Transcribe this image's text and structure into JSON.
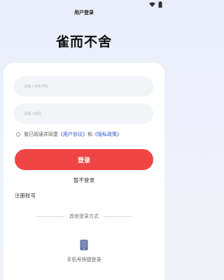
{
  "header": {
    "title": "用户登录"
  },
  "app": {
    "name": "雀而不舍"
  },
  "form": {
    "phone_placeholder": "请输入手机号码",
    "password_placeholder": "请输入密码"
  },
  "agreement": {
    "prefix": "我已阅读并同意",
    "user_agreement": "《用户协议》",
    "conjunction": "和",
    "privacy_policy": "《隐私政策》"
  },
  "actions": {
    "login_label": "登录",
    "skip_label": "暂不登录",
    "register_label": "注册账号"
  },
  "other_login": {
    "label": "其他登录方式",
    "phone_quick_label": "手机号快捷登录"
  },
  "colors": {
    "accent": "#ef4444",
    "link": "#2b56d6"
  },
  "icons": [
    "wifi-icon",
    "battery-icon",
    "phone-icon"
  ]
}
